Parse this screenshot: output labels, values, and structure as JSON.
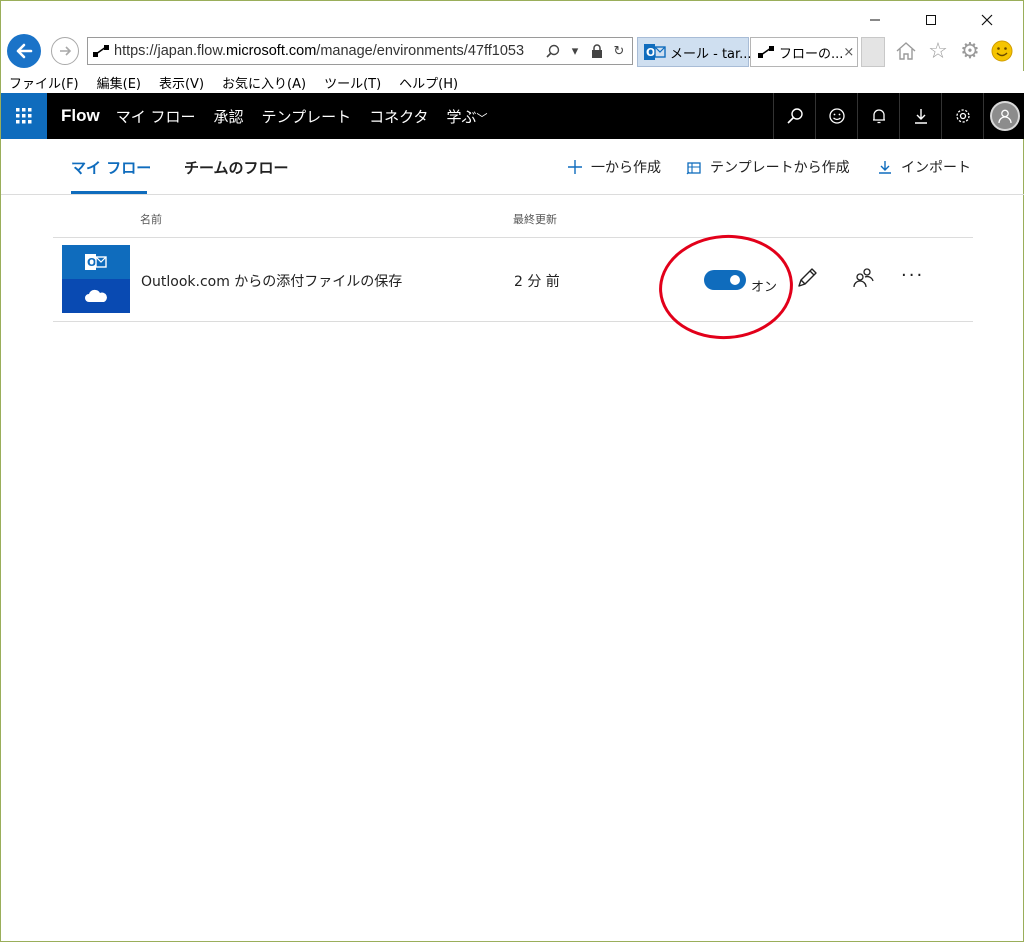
{
  "browser": {
    "url_prefix": "https://japan.flow.",
    "url_domain": "microsoft.com",
    "url_path": "/manage/environments/47ff1053",
    "tabs": [
      {
        "label": "メール - tar..."
      },
      {
        "label": "フローの..."
      }
    ],
    "tab_close": "×",
    "menu": [
      "ファイル(F)",
      "編集(E)",
      "表示(V)",
      "お気に入り(A)",
      "ツール(T)",
      "ヘルプ(H)"
    ]
  },
  "flow_header": {
    "brand": "Flow",
    "nav": [
      "マイ フロー",
      "承認",
      "テンプレート",
      "コネクタ",
      "学ぶ"
    ]
  },
  "subtabs": {
    "my_flows": "マイ フロー",
    "team_flows": "チームのフロー",
    "actions": [
      "一から作成",
      "テンプレートから作成",
      "インポート"
    ]
  },
  "list": {
    "col_name": "名前",
    "col_modified": "最終更新",
    "rows": [
      {
        "name": "Outlook.com からの添付ファイルの保存",
        "modified": "2 分 前",
        "status_label": "オン",
        "more": "···"
      }
    ]
  },
  "colors": {
    "accent": "#0f6cbd",
    "highlight": "#e2001a"
  }
}
